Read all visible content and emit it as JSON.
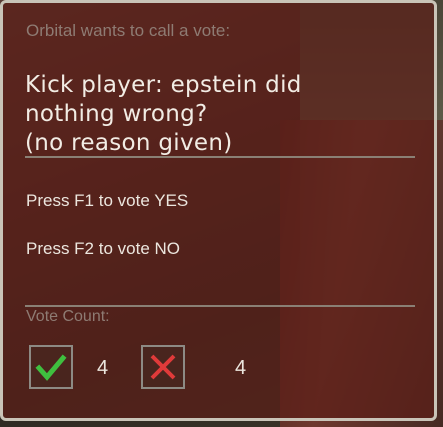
{
  "vote_panel": {
    "header": "Orbital wants to call a vote:",
    "question_lines": [
      "Kick player: epstein did",
      "nothing wrong?",
      "(no reason given)"
    ],
    "options": {
      "yes_text": "Press F1 to vote YES",
      "no_text": "Press F2 to vote NO"
    },
    "count_label": "Vote Count:",
    "counts": {
      "yes_icon": "checkmark-icon",
      "yes": "4",
      "no_icon": "cross-icon",
      "no": "4"
    },
    "colors": {
      "panel_bg": "#5c1e18",
      "border": "#c9c4b8",
      "yes_green": "#3fbf3f",
      "no_red": "#e03a3a"
    }
  }
}
